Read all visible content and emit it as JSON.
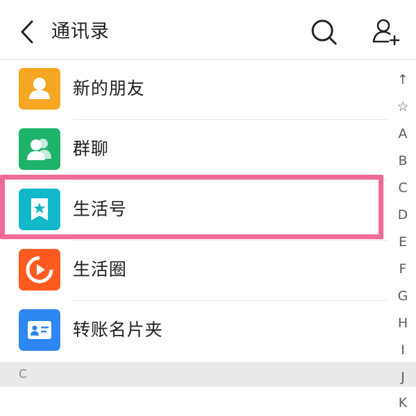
{
  "header": {
    "title": "通讯录",
    "back_icon": "chevron-left-icon",
    "search_icon": "search-icon",
    "add_contact_icon": "add-contact-icon"
  },
  "list": {
    "items": [
      {
        "label": "新的朋友",
        "icon": "person-icon",
        "color": "#f5a623"
      },
      {
        "label": "群聊",
        "icon": "group-icon",
        "color": "#1db36b"
      },
      {
        "label": "生活号",
        "icon": "bookmark-star-icon",
        "color": "#12b8c9"
      },
      {
        "label": "生活圈",
        "icon": "play-circle-icon",
        "color": "#ff5a1f"
      },
      {
        "label": "转账名片夹",
        "icon": "business-card-icon",
        "color": "#2e86f0"
      }
    ],
    "highlighted_item": "生活号"
  },
  "section": {
    "letter": "C"
  },
  "index_bar": [
    "↑",
    "☆",
    "A",
    "B",
    "C",
    "D",
    "E",
    "F",
    "G",
    "H",
    "I",
    "J",
    "K"
  ],
  "colors": {
    "highlight_border": "#f06c96",
    "section_bg": "#e9e9e9",
    "separator": "#e8e8e8"
  }
}
